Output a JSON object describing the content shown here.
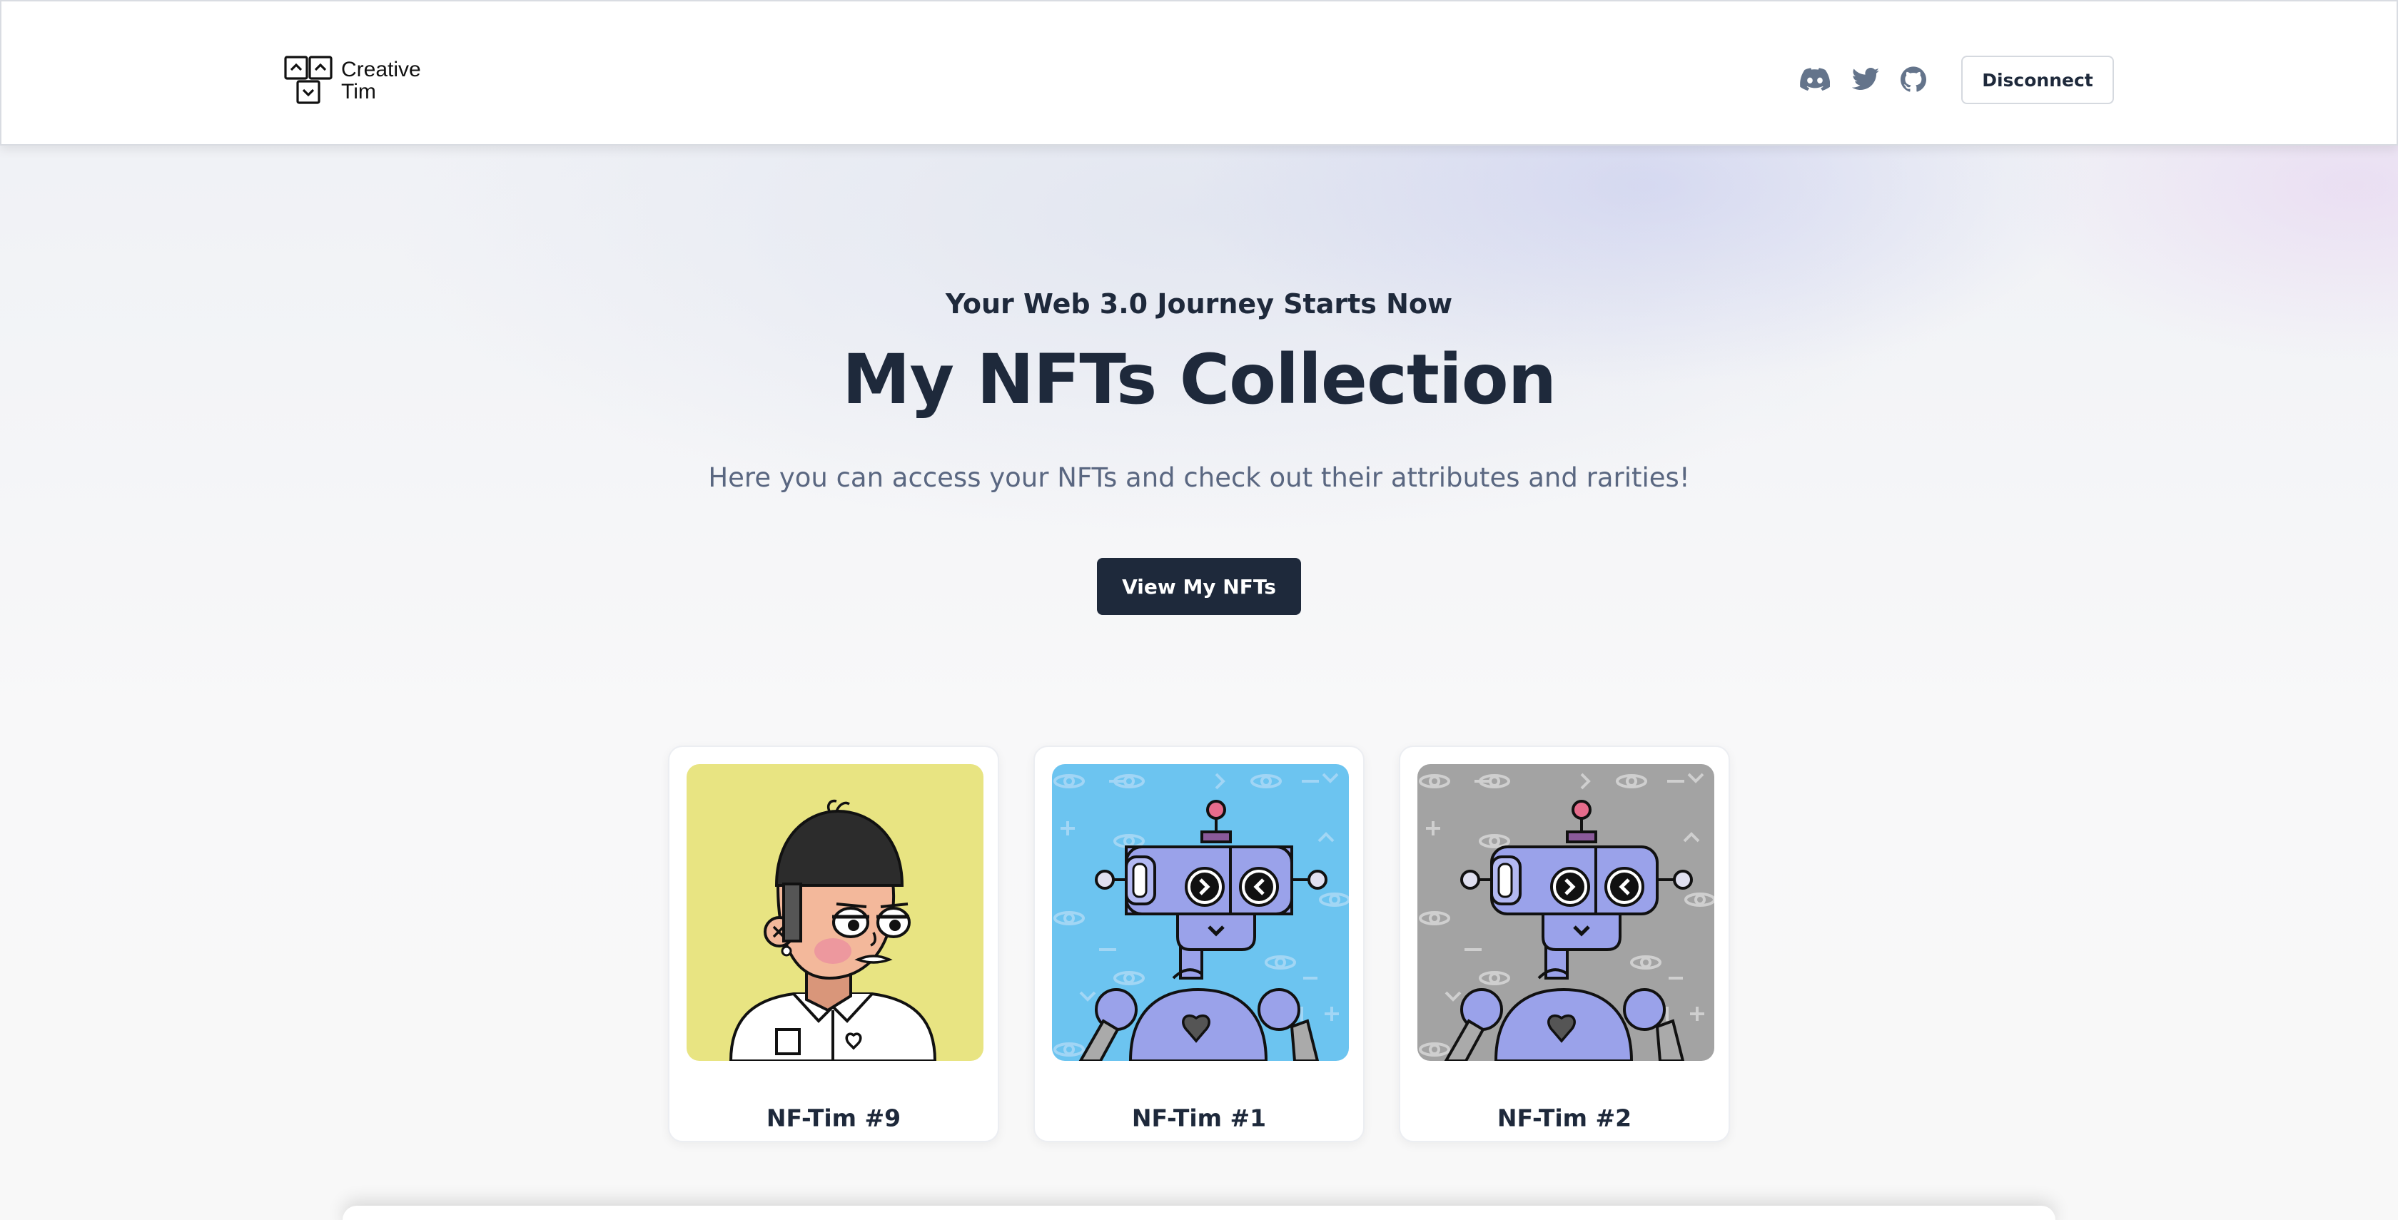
{
  "header": {
    "logo_line1": "Creative",
    "logo_line2": "Tim",
    "icons": [
      "discord-icon",
      "twitter-icon",
      "github-icon"
    ],
    "disconnect_label": "Disconnect"
  },
  "hero": {
    "subtitle": "Your Web 3.0 Journey Starts Now",
    "title": "My NFTs Collection",
    "description": "Here you can access your NFTs and check out their attributes and rarities!",
    "cta_label": "View My NFTs"
  },
  "nfts": [
    {
      "name": "NF-Tim #9",
      "background": "#e8e482"
    },
    {
      "name": "NF-Tim #1",
      "background": "#6cc4f0"
    },
    {
      "name": "NF-Tim #2",
      "background": "#a3a3a3"
    }
  ],
  "colors": {
    "primary": "#1e293b",
    "muted_text": "#5a6781",
    "icon_gray": "#64748b",
    "robot_purple": "#9aa2ea"
  }
}
